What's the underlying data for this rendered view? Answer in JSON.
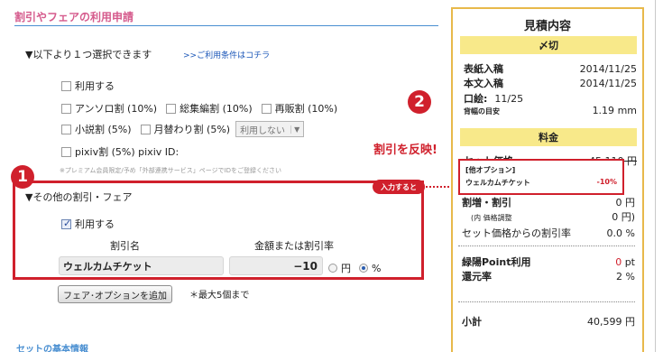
{
  "form": {
    "section_title": "割引やフェアの利用申請",
    "select_note": "▼以下より１つ選択できます",
    "conditions_link": ">>ご利用条件はコチラ",
    "use_label": "利用する",
    "discounts_row1": [
      "アンソロ割 (10%)",
      "総集編割 (10%)",
      "再販割 (10%)"
    ],
    "discounts_row2": [
      "小説割 (5%)",
      "月替わり割 (5%)"
    ],
    "monthly_select_value": "利用しない",
    "pixiv_label": "pixiv割 (5%) pixiv ID:",
    "premium_note": "※プレミアム会員限定/予め「外部連携サービス」ページでIDをご登録ください",
    "other_title": "▼その他の割引・フェア",
    "other_use_label": "利用する",
    "col_name": "割引名",
    "col_amount": "金額または割引率",
    "discount_name_value": "ウェルカムチケット",
    "discount_amount_value": "−10",
    "unit_yen": "円",
    "unit_percent": "%",
    "add_button": "フェア･オプションを追加",
    "max_note": "＊最大5個まで",
    "next_section_cutoff": "セットの基本情報"
  },
  "annotations": {
    "num1": "1",
    "num2": "2",
    "reflect_text": "割引を反映!",
    "input_pill": "入力すると"
  },
  "summary": {
    "title": "見積内容",
    "deadline_band": "〆切",
    "cover_label": "表紙入稿",
    "cover_date": "2014/11/25",
    "body_label": "本文入稿",
    "body_date": "2014/11/25",
    "delivery_label": "口絵:",
    "delivery_date": "11/25",
    "spine_label": "背幅の目安",
    "spine_value": "1.19",
    "spine_unit": "mm",
    "fee_band": "料金",
    "set_price_label": "セット価格",
    "set_price_value": "45,110",
    "set_price_unit": "円",
    "other_options_label": "[他オプション]",
    "welcome_label": "ウェルカムチケット",
    "welcome_value": "-10%",
    "increase_label": "割増・割引",
    "increase_value": "0",
    "increase_unit": "円",
    "price_adjust_label": "(内 価格調整",
    "price_adjust_value": "0",
    "price_adjust_unit": "円)",
    "discount_rate_label": "セット価格からの割引率",
    "discount_rate_value": "0.0",
    "discount_rate_unit": "%",
    "point_label": "緑陽Point利用",
    "point_value": "0",
    "point_unit": "pt",
    "return_label": "還元率",
    "return_value": "2",
    "return_unit": "%",
    "subtotal_label": "小計",
    "subtotal_value": "40,599",
    "subtotal_unit": "円"
  },
  "colors": {
    "accent_red": "#d0202c",
    "title_pink": "#d55a8c",
    "rule_blue": "#4a8fd1",
    "panel_border": "#e8b94a",
    "band_yellow": "#f8e98a"
  }
}
